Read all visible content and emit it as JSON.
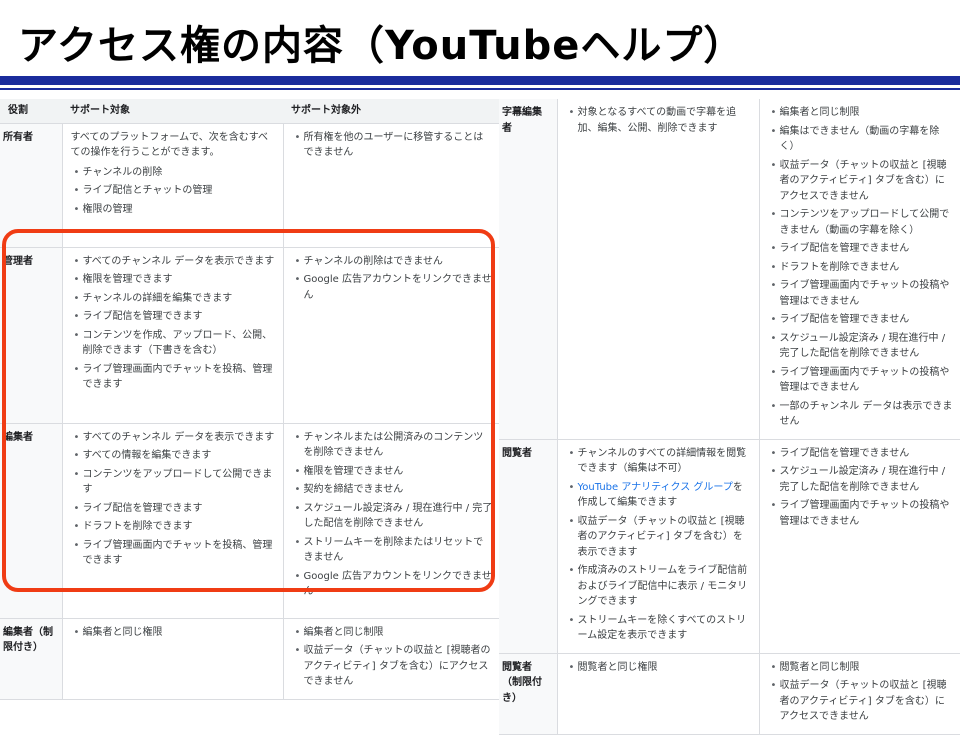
{
  "slide": {
    "title": "アクセス権の内容（YouTubeヘルプ）"
  },
  "left_table": {
    "headers": [
      "役割",
      "サポート対象",
      "サポート対象外"
    ],
    "rows": [
      {
        "role": "所有者",
        "supported_intro": "すべてのプラットフォームで、次を含むすべての操作を行うことができます。",
        "supported": [
          "チャンネルの削除",
          "ライブ配信とチャットの管理",
          "権限の管理"
        ],
        "unsupported": [
          "所有権を他のユーザーに移管することはできません"
        ]
      },
      {
        "role": "管理者",
        "supported_intro": "",
        "supported": [
          "すべてのチャンネル データを表示できます",
          "権限を管理できます",
          "チャンネルの詳細を編集できます",
          "ライブ配信を管理できます",
          "コンテンツを作成、アップロード、公開、削除できます（下書きを含む）",
          "ライブ管理画面内でチャットを投稿、管理できます"
        ],
        "unsupported": [
          "チャンネルの削除はできません",
          "Google 広告アカウントをリンクできません"
        ]
      },
      {
        "role": "編集者",
        "supported_intro": "",
        "supported": [
          "すべてのチャンネル データを表示できます",
          "すべての情報を編集できます",
          "コンテンツをアップロードして公開できます",
          "ライブ配信を管理できます",
          "ドラフトを削除できます",
          "ライブ管理画面内でチャットを投稿、管理できます"
        ],
        "unsupported": [
          "チャンネルまたは公開済みのコンテンツを削除できません",
          "権限を管理できません",
          "契約を締結できません",
          "スケジュール設定済み / 現在進行中 / 完了した配信を削除できません",
          "ストリームキーを削除またはリセットできません",
          "Google 広告アカウントをリンクできません"
        ]
      },
      {
        "role": "編集者（制限付き）",
        "supported_intro": "",
        "supported": [
          "編集者と同じ権限"
        ],
        "unsupported": [
          "編集者と同じ制限",
          "収益データ（チャットの収益と [視聴者のアクティビティ] タブを含む）にアクセスできません"
        ]
      }
    ]
  },
  "right_table": {
    "rows": [
      {
        "role": "字幕編集者",
        "supported_prefix": "",
        "supported_link": "",
        "supported_suffix": "",
        "supported": [
          "対象となるすべての動画で字幕を追加、編集、公開、削除できます"
        ],
        "supported_rest": [],
        "unsupported": [
          "編集者と同じ制限",
          "編集はできません（動画の字幕を除く）",
          "収益データ（チャットの収益と [視聴者のアクティビティ] タブを含む）にアクセスできません",
          "コンテンツをアップロードして公開できません（動画の字幕を除く）",
          "ライブ配信を管理できません",
          "ドラフトを削除できません",
          "ライブ管理画面内でチャットの投稿や管理はできません",
          "ライブ配信を管理できません",
          "スケジュール設定済み / 現在進行中 / 完了した配信を削除できません",
          "ライブ管理画面内でチャットの投稿や管理はできません",
          "一部のチャンネル データは表示できません"
        ]
      },
      {
        "role": "閲覧者",
        "supported_prefix": "",
        "supported_link": "YouTube アナリティクス グループ",
        "supported_suffix": "を作成して編集できます",
        "supported": [
          "チャンネルのすべての詳細情報を閲覧できます（編集は不可）"
        ],
        "supported_rest": [
          "収益データ（チャットの収益と [視聴者のアクティビティ] タブを含む）を表示できます",
          "作成済みのストリームをライブ配信前およびライブ配信中に表示 / モニタリングできます",
          "ストリームキーを除くすべてのストリーム設定を表示できます"
        ],
        "unsupported": [
          "ライブ配信を管理できません",
          "スケジュール設定済み / 現在進行中 / 完了した配信を削除できません",
          "ライブ管理画面内でチャットの投稿や管理はできません"
        ]
      },
      {
        "role": "閲覧者（制限付き）",
        "supported_prefix": "",
        "supported_link": "",
        "supported_suffix": "",
        "supported": [
          "閲覧者と同じ権限"
        ],
        "supported_rest": [],
        "unsupported": [
          "閲覧者と同じ制限",
          "収益データ（チャットの収益と [視聴者のアクティビティ] タブを含む）にアクセスできません"
        ]
      }
    ]
  }
}
